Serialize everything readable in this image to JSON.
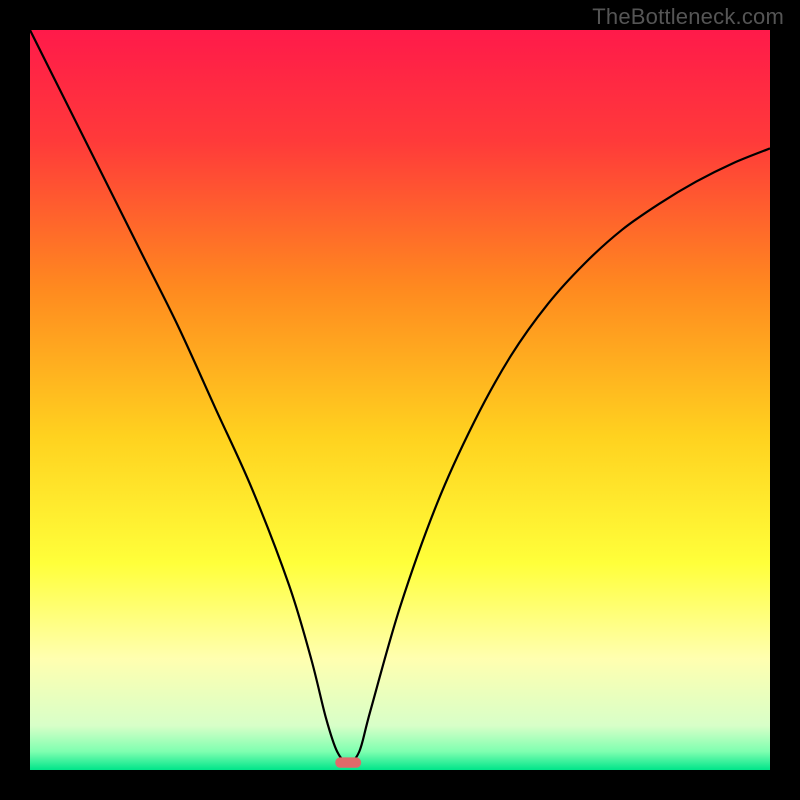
{
  "watermark": "TheBottleneck.com",
  "chart_data": {
    "type": "line",
    "title": "",
    "xlabel": "",
    "ylabel": "",
    "xlim": [
      0,
      100
    ],
    "ylim": [
      0,
      100
    ],
    "gradient_stops": [
      {
        "offset": 0.0,
        "color": "#ff1a4a"
      },
      {
        "offset": 0.15,
        "color": "#ff3a3a"
      },
      {
        "offset": 0.35,
        "color": "#ff8a1f"
      },
      {
        "offset": 0.55,
        "color": "#ffd21f"
      },
      {
        "offset": 0.72,
        "color": "#ffff3a"
      },
      {
        "offset": 0.85,
        "color": "#ffffb0"
      },
      {
        "offset": 0.94,
        "color": "#d8ffc8"
      },
      {
        "offset": 0.975,
        "color": "#7fffb0"
      },
      {
        "offset": 1.0,
        "color": "#00e58a"
      }
    ],
    "series": [
      {
        "name": "curve",
        "x": [
          0,
          5,
          10,
          15,
          20,
          25,
          30,
          35,
          38,
          40,
          41.5,
          43,
          44.5,
          46,
          50,
          55,
          60,
          65,
          70,
          75,
          80,
          85,
          90,
          95,
          100
        ],
        "y": [
          100,
          90,
          80,
          70,
          60,
          49,
          38,
          25,
          15,
          7,
          2.5,
          1,
          2.5,
          8,
          22,
          36,
          47,
          56,
          63,
          68.5,
          73,
          76.5,
          79.5,
          82,
          84
        ]
      }
    ],
    "marker": {
      "name": "min-marker",
      "x": 43,
      "y": 1,
      "width": 3.5,
      "height": 1.4,
      "color": "#e06a6a"
    }
  }
}
